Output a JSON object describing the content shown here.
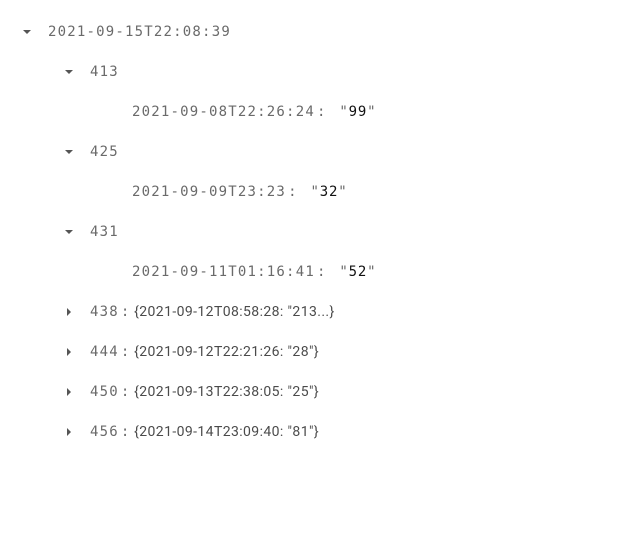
{
  "root": {
    "key": "2021-09-15T22:08:39",
    "children": [
      {
        "key": "413",
        "expanded": true,
        "leaf": {
          "key": "2021-09-08T22:26:24",
          "value": "99"
        }
      },
      {
        "key": "425",
        "expanded": true,
        "leaf": {
          "key": "2021-09-09T23:23",
          "value": "32"
        }
      },
      {
        "key": "431",
        "expanded": true,
        "leaf": {
          "key": "2021-09-11T01:16:41",
          "value": "52"
        }
      },
      {
        "key": "438",
        "expanded": false,
        "preview": "{2021-09-12T08:58:28: \"213...}"
      },
      {
        "key": "444",
        "expanded": false,
        "preview": "{2021-09-12T22:21:26: \"28\"}"
      },
      {
        "key": "450",
        "expanded": false,
        "preview": "{2021-09-13T22:38:05: \"25\"}"
      },
      {
        "key": "456",
        "expanded": false,
        "preview": "{2021-09-14T23:09:40: \"81\"}"
      }
    ]
  }
}
